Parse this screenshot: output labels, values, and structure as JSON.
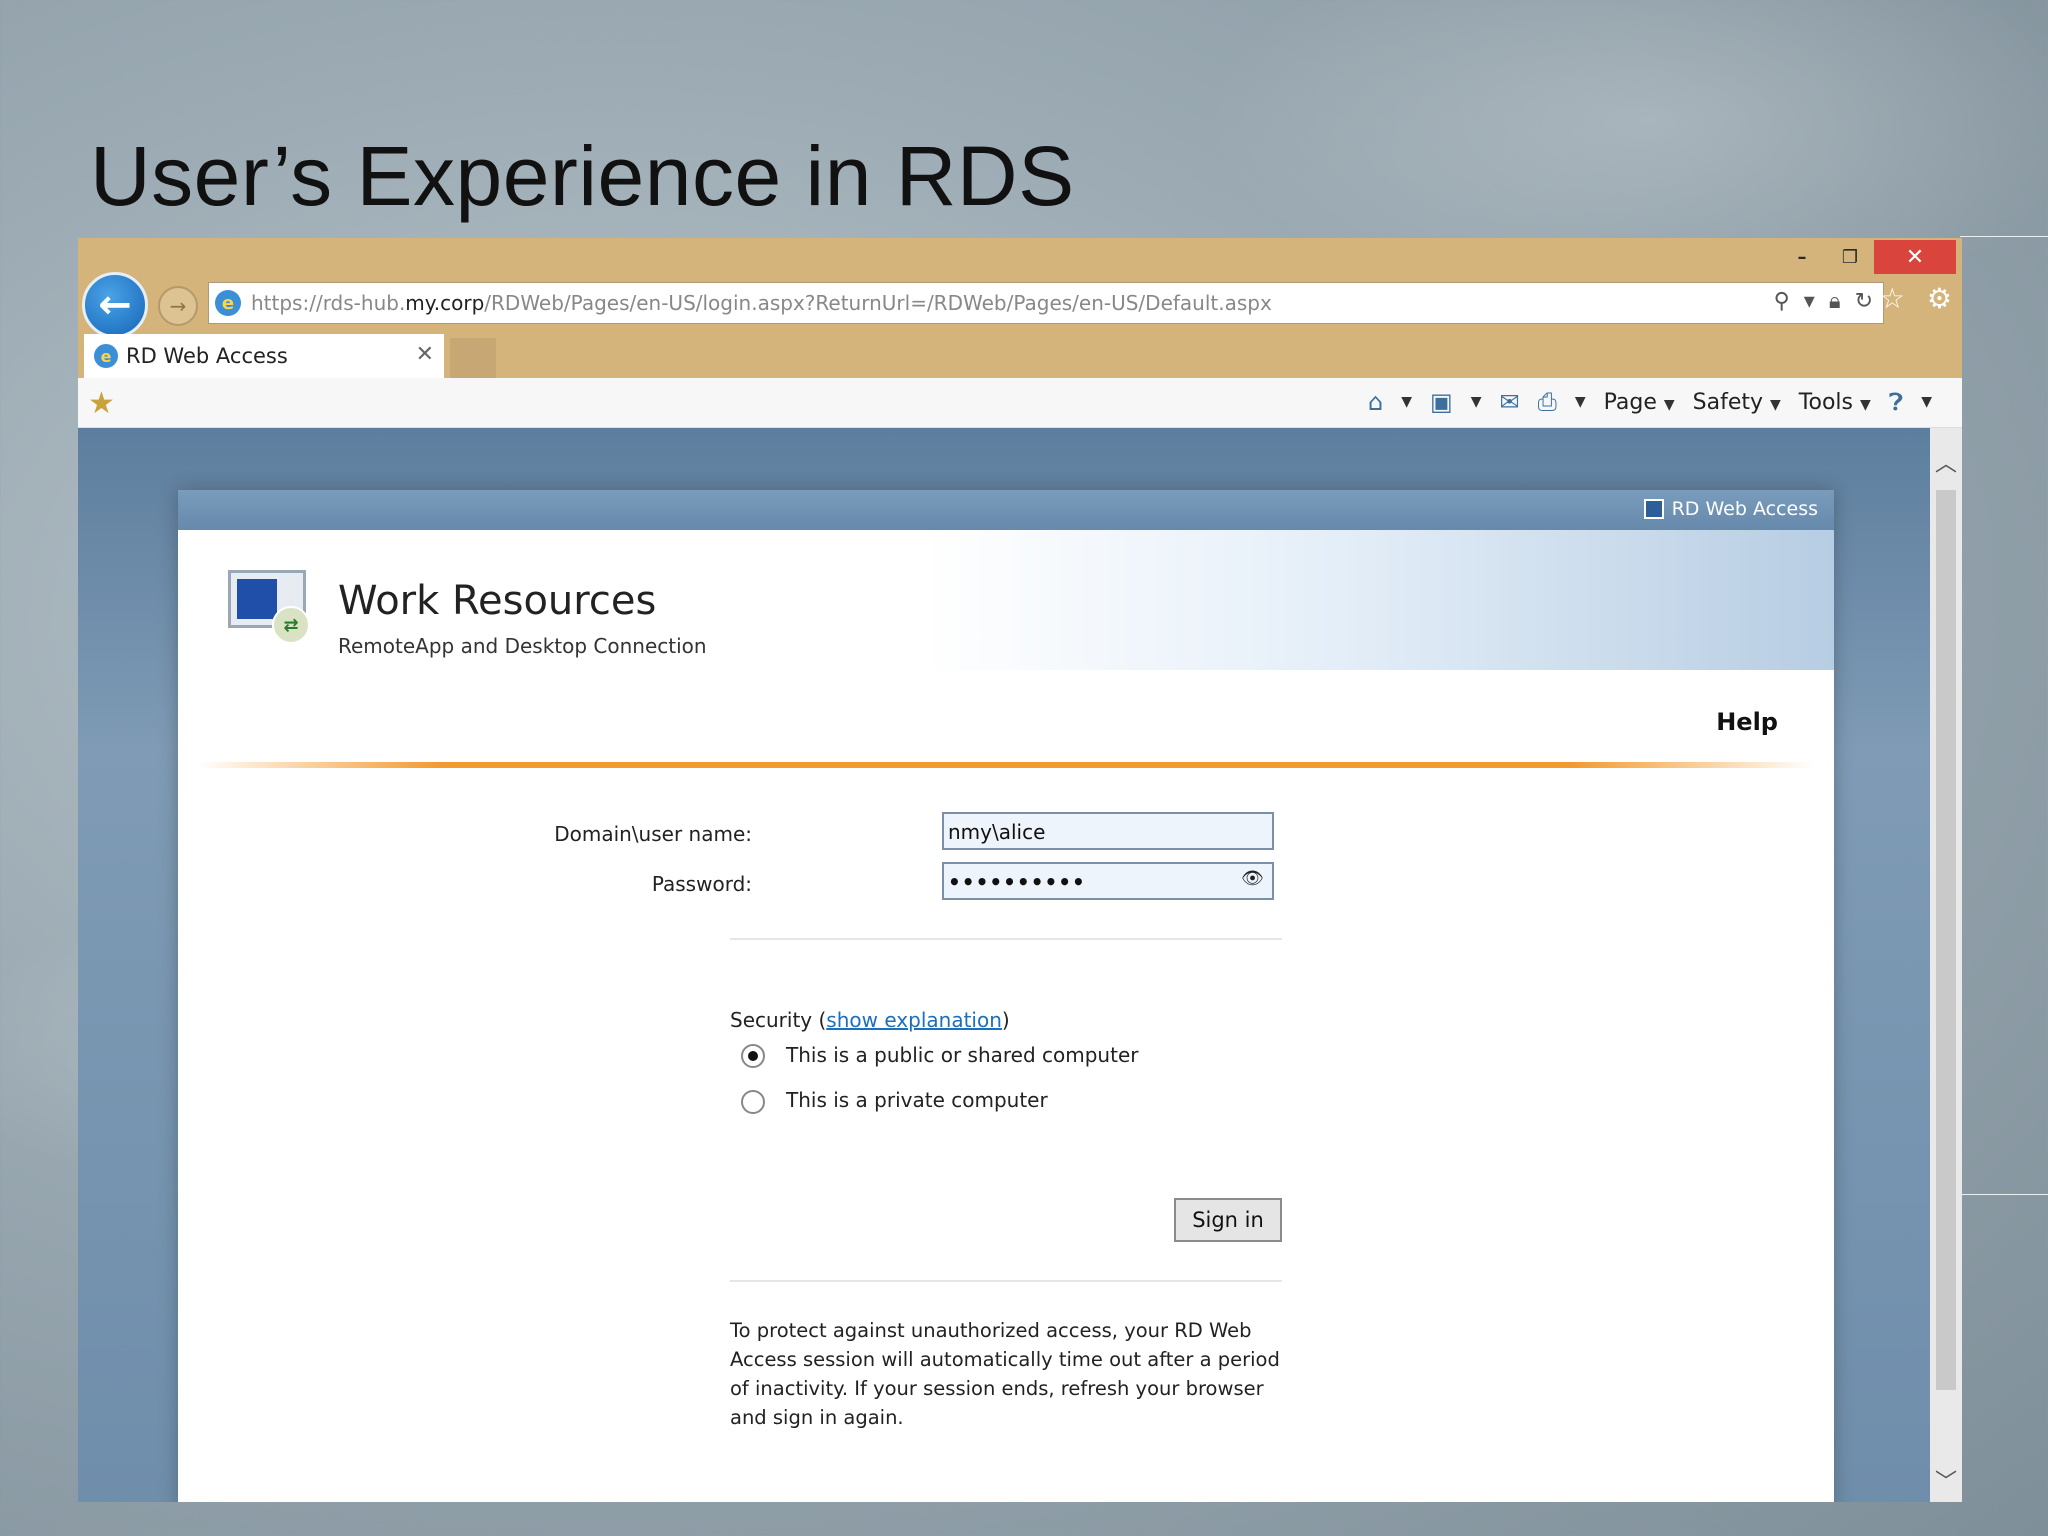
{
  "slide": {
    "title": "User’s Experience in RDS"
  },
  "window": {
    "minimize": "–",
    "restore": "❐",
    "close": "✕"
  },
  "address": {
    "url_prefix": "https://rds-hub.",
    "url_domain": "my.corp",
    "url_path": "/RDWeb/Pages/en-US/login.aspx?ReturnUrl=/RDWeb/Pages/en-US/Default.aspx"
  },
  "tab": {
    "label": "RD Web Access",
    "close": "✕"
  },
  "command_bar": {
    "page": "Page",
    "safety": "Safety",
    "tools": "Tools"
  },
  "rdweb": {
    "topbar_label": "RD Web Access",
    "title": "Work Resources",
    "subtitle": "RemoteApp and Desktop Connection",
    "help": "Help",
    "form": {
      "username_label": "Domain\\user name:",
      "username_value": "nmy\\alice",
      "password_label": "Password:",
      "password_value": "••••••••••"
    },
    "security": {
      "label": "Security (",
      "link": "show explanation",
      "label_end": ")",
      "options": [
        {
          "label": "This is a public or shared computer",
          "checked": true
        },
        {
          "label": "This is a private computer",
          "checked": false
        }
      ]
    },
    "sign_in": "Sign in",
    "notice": "To protect against unauthorized access, your RD Web Access session will automatically time out after a period of inactivity. If your session ends, refresh your browser and sign in again."
  },
  "colors": {
    "browser_frame": "#d5b47c",
    "accent_orange": "#f39a2e",
    "link_blue": "#1a6fc0",
    "close_red": "#d9443d"
  }
}
